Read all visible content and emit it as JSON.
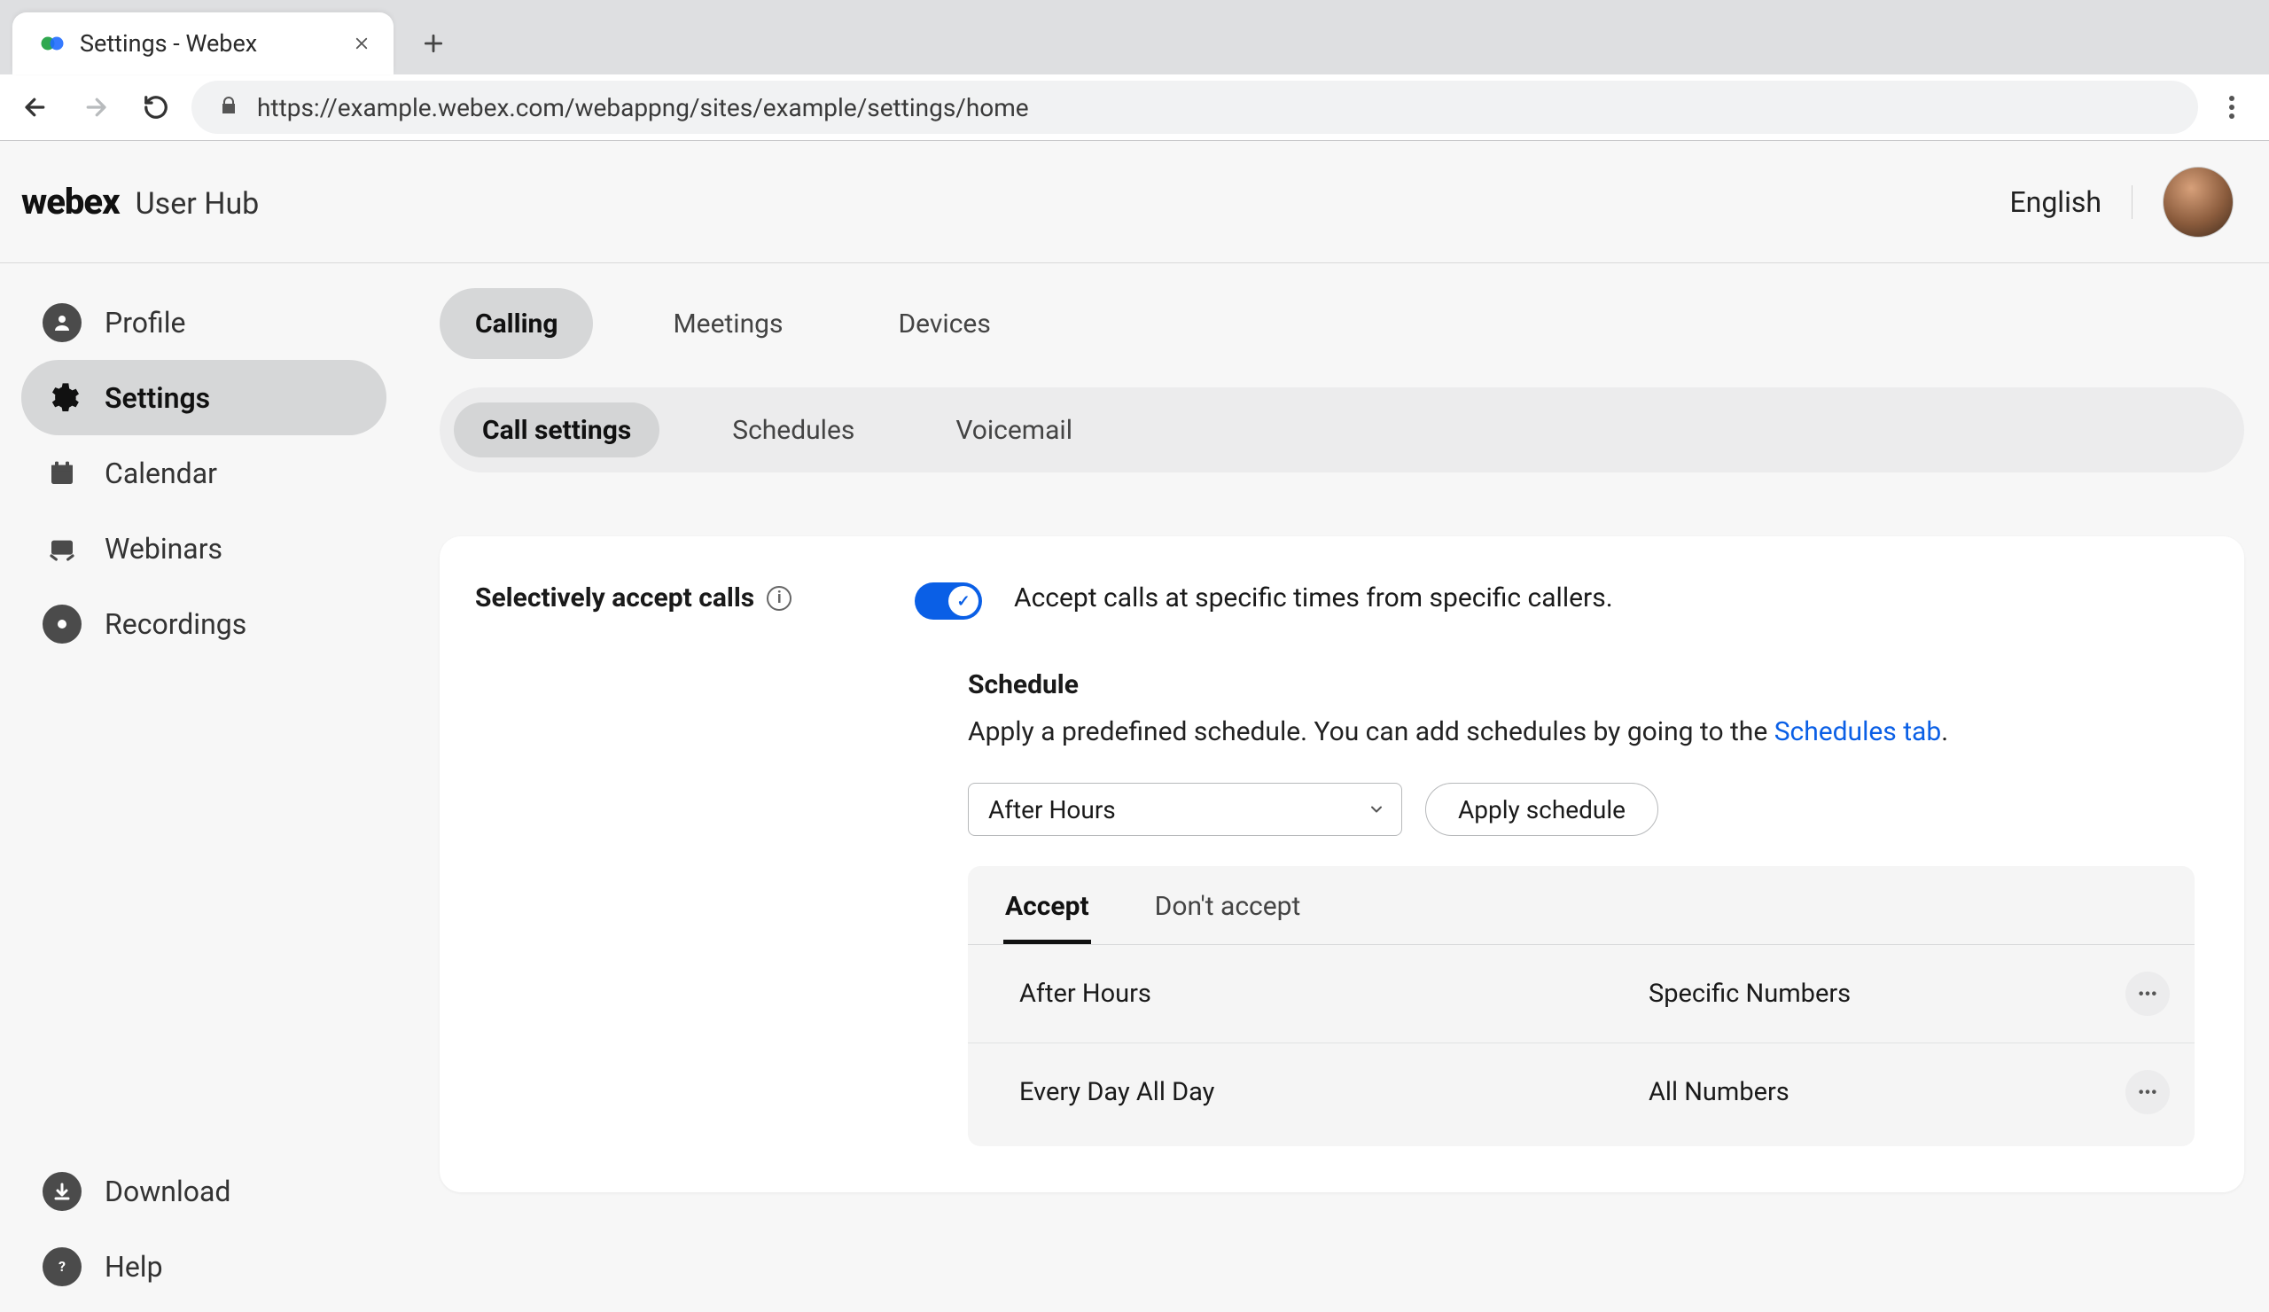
{
  "browser": {
    "tab_title": "Settings - Webex",
    "url": "https://example.webex.com/webappng/sites/example/settings/home"
  },
  "brand": {
    "logo": "webex",
    "sub": "User Hub"
  },
  "top": {
    "language": "English"
  },
  "sidebar": {
    "items": [
      {
        "label": "Profile"
      },
      {
        "label": "Settings"
      },
      {
        "label": "Calendar"
      },
      {
        "label": "Webinars"
      },
      {
        "label": "Recordings"
      }
    ],
    "bottom": [
      {
        "label": "Download"
      },
      {
        "label": "Help"
      }
    ]
  },
  "tabs1": {
    "calling": "Calling",
    "meetings": "Meetings",
    "devices": "Devices"
  },
  "tabs2": {
    "call_settings": "Call settings",
    "schedules": "Schedules",
    "voicemail": "Voicemail"
  },
  "sac": {
    "label": "Selectively accept calls",
    "desc": "Accept calls at specific times from specific callers."
  },
  "schedule": {
    "title": "Schedule",
    "desc_a": "Apply a predefined schedule. You can add schedules by going to the ",
    "desc_link": "Schedules tab",
    "desc_b": ".",
    "select_value": "After Hours",
    "apply_btn": "Apply schedule"
  },
  "inner_tabs": {
    "accept": "Accept",
    "dont_accept": "Don't accept"
  },
  "rules": [
    {
      "name": "After Hours",
      "target": "Specific Numbers"
    },
    {
      "name": "Every Day All Day",
      "target": "All Numbers"
    }
  ]
}
